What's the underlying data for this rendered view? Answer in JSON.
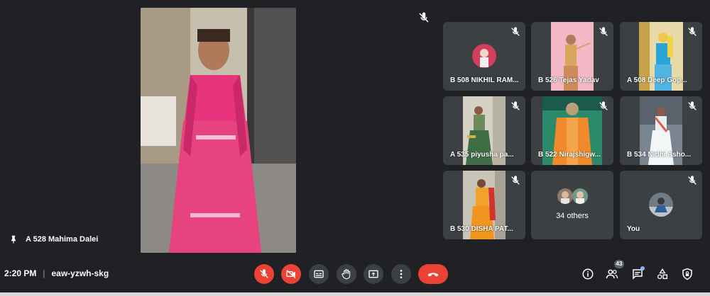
{
  "presenter": {
    "name": "A 528 Mahima Dalei",
    "pin_icon": "pin-icon",
    "mute_icon": "mic-off-icon"
  },
  "tiles": [
    {
      "name": "B 508 NIKHIL RAM...",
      "type": "avatar"
    },
    {
      "name": "B 526 Tejas Yadav",
      "type": "video"
    },
    {
      "name": "A 508 Deep Gop...",
      "type": "video"
    },
    {
      "name": "A 535 piyusha pa...",
      "type": "video"
    },
    {
      "name": "B 522 Nirajshigw...",
      "type": "video"
    },
    {
      "name": "B 534 Nidhi Asho...",
      "type": "video"
    },
    {
      "name": "B 530 DISHA PAT...",
      "type": "video"
    },
    {
      "name": "34 others",
      "type": "others"
    },
    {
      "name": "You",
      "type": "avatar"
    }
  ],
  "meeting": {
    "time": "2:20 PM",
    "separator": "|",
    "code": "eaw-yzwh-skg"
  },
  "controls": {
    "people_count": "43"
  },
  "colors": {
    "background": "#202124",
    "tile": "#3c4043",
    "danger": "#ea4335",
    "accent": "#8ab4f8"
  }
}
